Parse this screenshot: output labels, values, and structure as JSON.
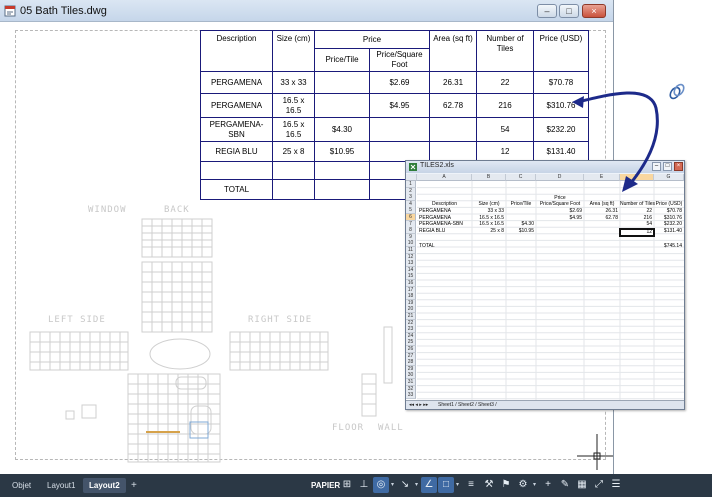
{
  "window": {
    "title": "05 Bath Tiles.dwg",
    "controls": [
      "–",
      "□",
      "×"
    ]
  },
  "table": {
    "headers": {
      "description": "Description",
      "size": "Size (cm)",
      "price": "Price",
      "price_tile": "Price/Tile",
      "price_sqft": "Price/Square Foot",
      "area": "Area (sq ft)",
      "num_tiles": "Number of Tiles",
      "price_usd": "Price (USD)"
    },
    "rows": [
      {
        "description": "PERGAMENA",
        "size": "33 x 33",
        "price_tile": "",
        "price_sqft": "$2.69",
        "area": "26.31",
        "num_tiles": "22",
        "price_usd": "$70.78"
      },
      {
        "description": "PERGAMENA",
        "size": "16.5 x 16.5",
        "price_tile": "",
        "price_sqft": "$4.95",
        "area": "62.78",
        "num_tiles": "216",
        "price_usd": "$310.76"
      },
      {
        "description": "PERGAMENA-SBN",
        "size": "16.5 x 16.5",
        "price_tile": "$4.30",
        "price_sqft": "",
        "area": "",
        "num_tiles": "54",
        "price_usd": "$232.20"
      },
      {
        "description": "REGIA BLU",
        "size": "25 x 8",
        "price_tile": "$10.95",
        "price_sqft": "",
        "area": "",
        "num_tiles": "12",
        "price_usd": "$131.40"
      },
      {
        "description": "",
        "size": "",
        "price_tile": "",
        "price_sqft": "",
        "area": "",
        "num_tiles": "",
        "price_usd": ""
      },
      {
        "description": "TOTAL",
        "size": "",
        "price_tile": "",
        "price_sqft": "",
        "area": "",
        "num_tiles": "",
        "price_usd": ""
      }
    ]
  },
  "plan_labels": {
    "window": "WINDOW",
    "back": "BACK",
    "left_side": "LEFT SIDE",
    "right_side": "RIGHT SIDE",
    "floor": "FLOOR",
    "wall": "WALL"
  },
  "excel": {
    "title": "TILES2.xls",
    "columns": [
      "A",
      "B",
      "C",
      "D",
      "E",
      "F",
      "G"
    ],
    "row_numbers": [
      "1",
      "2",
      "3",
      "4",
      "5",
      "6",
      "7",
      "8",
      "9",
      "10",
      "11",
      "12",
      "13",
      "14",
      "15",
      "16",
      "17",
      "18",
      "19",
      "20",
      "21",
      "22",
      "23",
      "24",
      "25",
      "26",
      "27",
      "28",
      "29",
      "30",
      "31",
      "32",
      "33"
    ],
    "header_row1": {
      "price": "Price"
    },
    "header_row2": {
      "a": "Description",
      "b": "Size (cm)",
      "c": "Price/Tile",
      "d": "Price/Square Foot",
      "e": "Area (sq ft)",
      "f": "Number of Tiles",
      "g": "Price (USD)"
    },
    "data_rows": [
      {
        "a": "PERGAMENA",
        "b": "33 x 33",
        "c": "",
        "d": "$2.69",
        "e": "26.31",
        "f": "22",
        "g": "$70.78"
      },
      {
        "a": "PERGAMENA",
        "b": "16.5 x 16.5",
        "c": "",
        "d": "$4.95",
        "e": "62.78",
        "f": "216",
        "g": "$310.76"
      },
      {
        "a": "PERGAMENA-SBN",
        "b": "16.5 x 16.5",
        "c": "$4.30",
        "d": "",
        "e": "",
        "f": "54",
        "g": "$232.20"
      },
      {
        "a": "REGIA BLU",
        "b": "25 x 8",
        "c": "$10.95",
        "d": "",
        "e": "",
        "f": "12",
        "g": "$131.40"
      }
    ],
    "total_label": "TOTAL",
    "total_value": "$745.14",
    "sheet_tabs": "Sheet1 / Sheet2 / Sheet3 /"
  },
  "statusbar": {
    "tabs": [
      "Objet",
      "Layout1",
      "Layout2"
    ],
    "active_tab": "Layout2",
    "add_tab": "+",
    "space_label": "PAPIER"
  }
}
